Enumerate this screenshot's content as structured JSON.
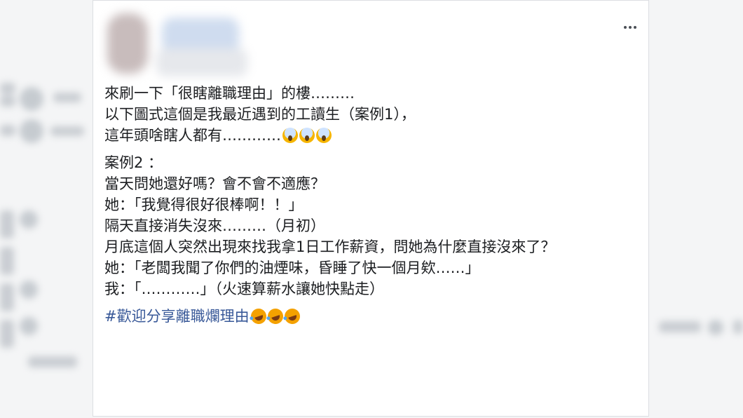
{
  "post": {
    "lines_top": [
      {
        "text": "來刷一下「很瞎離職理由」的樓………",
        "emoji": null
      },
      {
        "text": "以下圖式這個是我最近遇到的工讀生（案例1），",
        "emoji": null
      },
      {
        "text": "這年頭啥瞎人都有…………",
        "emoji": "screaming-face"
      }
    ],
    "lines_case": [
      "案例2 ：",
      "當天問她還好嗎？會不會不適應？",
      "她：「我覺得很好很棒啊！！」",
      "隔天直接消失沒來………（月初）",
      "月底這個人突然出現來找我拿1日工作薪資，問她為什麼直接沒來了？",
      "她：「老闆我聞了你們的油煙味，昏睡了快一個月欸……」",
      "我：「…………」（火速算薪水讓她快點走）"
    ],
    "hashtag": "#歡迎分享離職爛理由",
    "hashtag_emoji": "rolling-on-floor-laughing"
  },
  "icons": {
    "more": "more-options-icon"
  },
  "colors": {
    "text": "#1c1e21",
    "hashtag": "#385898",
    "card_bg": "#ffffff",
    "page_bg": "#f4f5f6"
  }
}
